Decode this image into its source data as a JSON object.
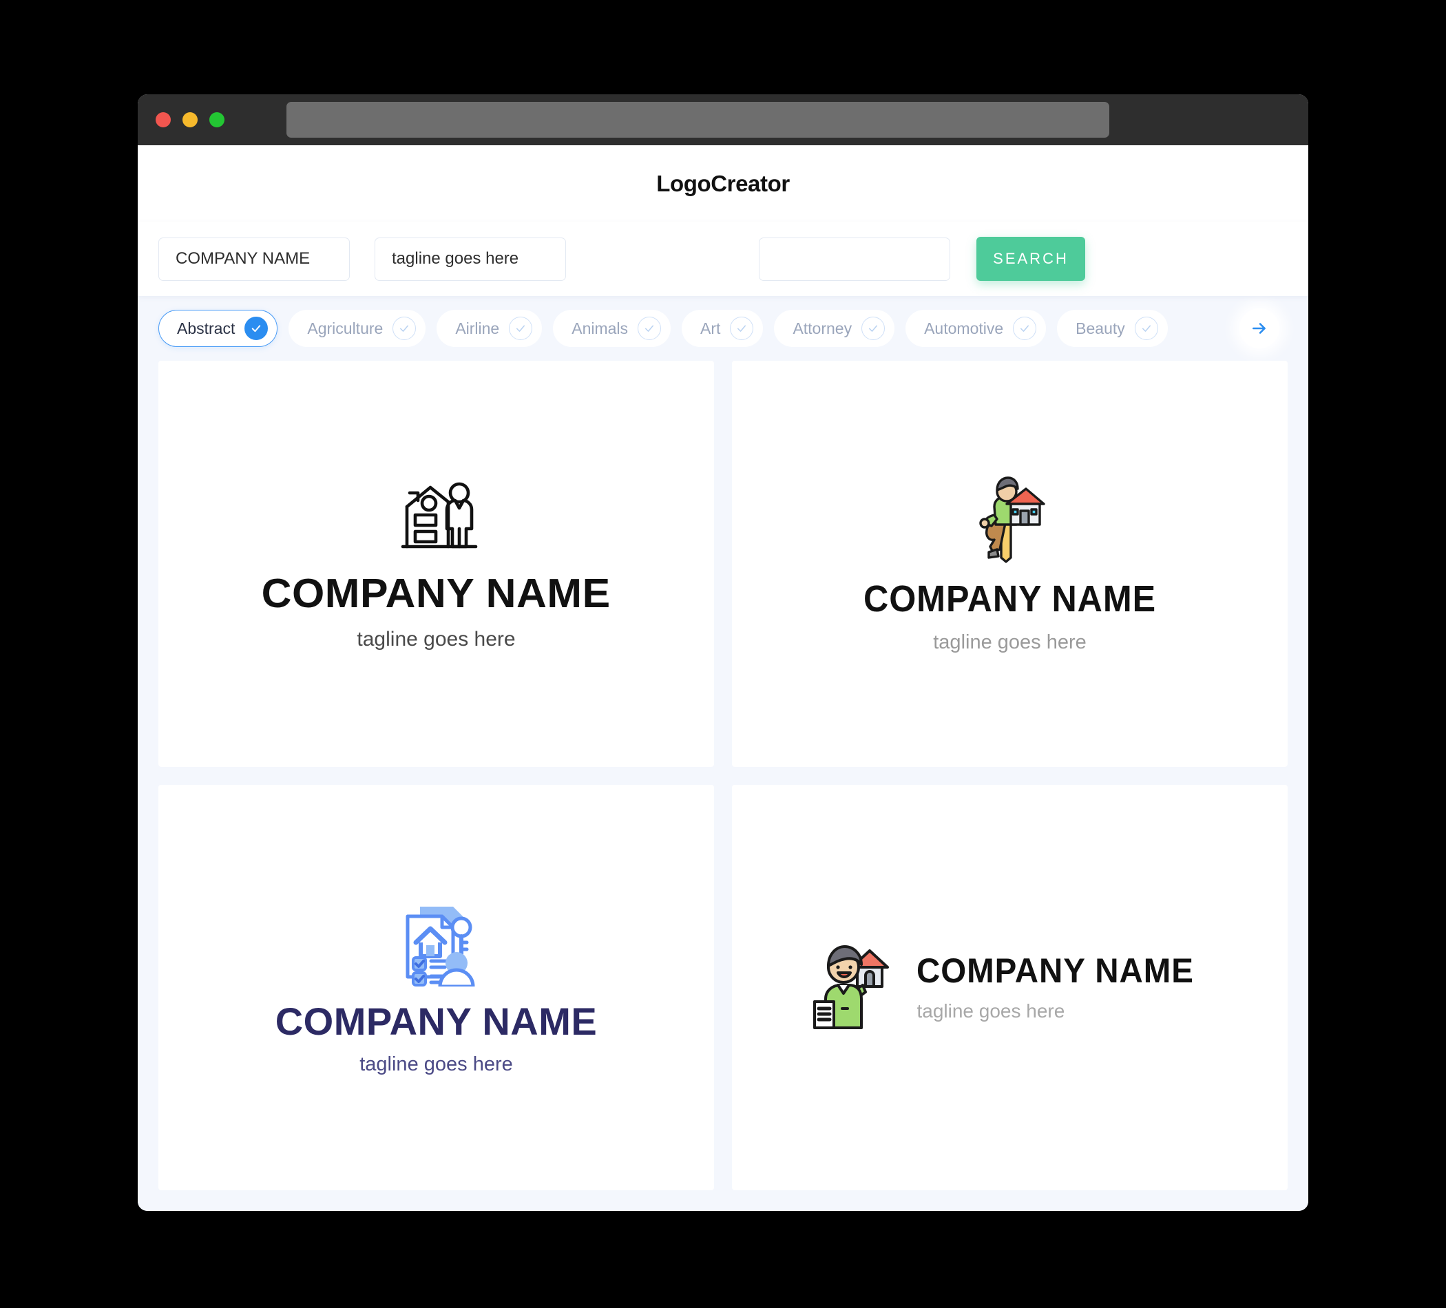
{
  "window": {
    "traffic_lights": [
      "close",
      "minimize",
      "maximize"
    ],
    "url_value": ""
  },
  "header": {
    "title": "LogoCreator"
  },
  "search": {
    "company_value": "COMPANY NAME",
    "company_placeholder": "COMPANY NAME",
    "tagline_value": "tagline goes here",
    "tagline_placeholder": "tagline goes here",
    "keyword_value": "",
    "keyword_placeholder": "",
    "search_label": "SEARCH"
  },
  "categories": {
    "next_icon": "arrow-right-icon",
    "items": [
      {
        "label": "Abstract",
        "selected": true
      },
      {
        "label": "Agriculture",
        "selected": false
      },
      {
        "label": "Airline",
        "selected": false
      },
      {
        "label": "Animals",
        "selected": false
      },
      {
        "label": "Art",
        "selected": false
      },
      {
        "label": "Attorney",
        "selected": false
      },
      {
        "label": "Automotive",
        "selected": false
      },
      {
        "label": "Beauty",
        "selected": false
      }
    ]
  },
  "results": [
    {
      "id": "logo-house-person-outline",
      "icon": "house-with-person-outline-icon",
      "company_name": "COMPANY NAME",
      "tagline": "tagline goes here",
      "name_color": "#111111",
      "tagline_color": "#4a4a4a",
      "layout": "stacked"
    },
    {
      "id": "logo-agent-key-house",
      "icon": "person-leaning-on-key-with-house-icon",
      "company_name": "COMPANY NAME",
      "tagline": "tagline goes here",
      "name_color": "#111111",
      "tagline_color": "#9a9a9a",
      "layout": "stacked"
    },
    {
      "id": "logo-contract-checklist",
      "icon": "house-contract-checklist-icon",
      "company_name": "COMPANY NAME",
      "tagline": "tagline goes here",
      "name_color": "#2c2a64",
      "tagline_color": "#4b4a86",
      "layout": "stacked"
    },
    {
      "id": "logo-agent-holding-house",
      "icon": "agent-holding-house-icon",
      "company_name": "COMPANY NAME",
      "tagline": "tagline goes here",
      "name_color": "#111111",
      "tagline_color": "#a8a8a8",
      "layout": "horizontal"
    }
  ],
  "colors": {
    "page_background": "#000000",
    "app_background": "#f4f7fd",
    "titlebar": "#2e2e2e",
    "search_button": "#4ecb9a",
    "accent_blue": "#2b8df0",
    "pill_text": "#9aa5bb"
  }
}
